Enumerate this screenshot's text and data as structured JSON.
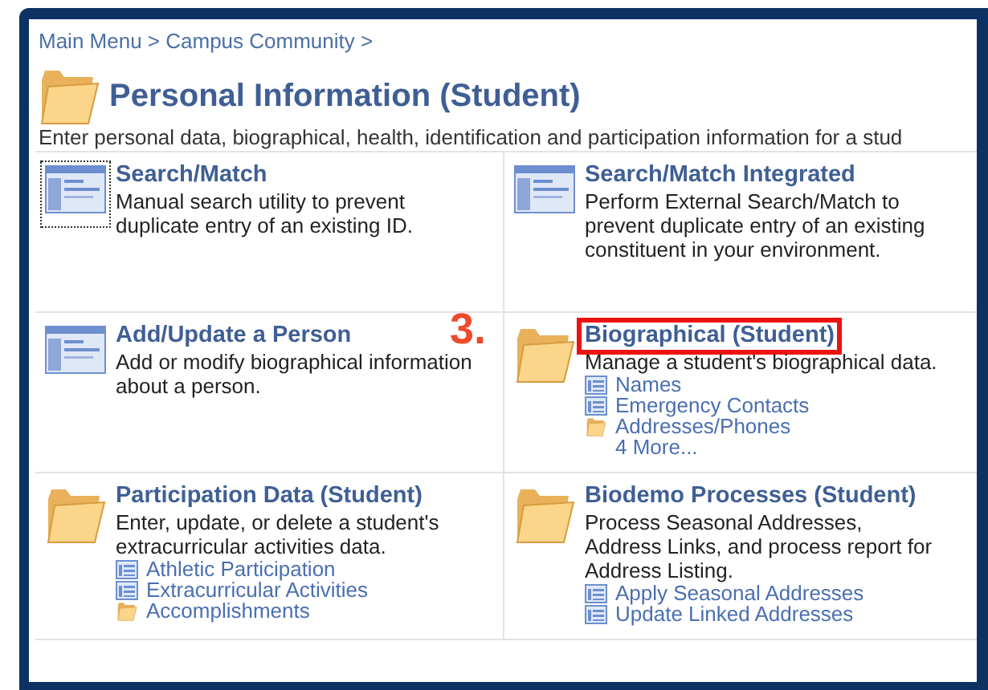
{
  "breadcrumb": "Main Menu > Campus Community >",
  "page": {
    "title": "Personal Information (Student)",
    "description": "Enter personal data, biographical, health, identification and participation information for a stud"
  },
  "annotation": "3.",
  "tiles": [
    {
      "kind": "page",
      "title": "Search/Match",
      "description": "Manual search utility to prevent duplicate entry of an existing ID.",
      "focused": true,
      "highlighted": false
    },
    {
      "kind": "page",
      "title": "Search/Match Integrated",
      "description": "Perform External Search/Match to prevent duplicate entry of an existing constituent in your environment.",
      "focused": false,
      "highlighted": false
    },
    {
      "kind": "page",
      "title": "Add/Update a Person",
      "description": "Add or modify biographical information about a person.",
      "focused": false,
      "highlighted": false
    },
    {
      "kind": "folder",
      "title": "Biographical (Student)",
      "description": "Manage a student's biographical data.",
      "focused": false,
      "highlighted": true,
      "links": [
        {
          "kind": "page",
          "label": "Names"
        },
        {
          "kind": "page",
          "label": "Emergency Contacts"
        },
        {
          "kind": "folder",
          "label": "Addresses/Phones"
        },
        {
          "kind": "more",
          "label": "4 More..."
        }
      ]
    },
    {
      "kind": "folder",
      "title": "Participation Data (Student)",
      "description": "Enter, update, or delete a student's extracurricular activities data.",
      "focused": false,
      "highlighted": false,
      "links": [
        {
          "kind": "page",
          "label": "Athletic Participation"
        },
        {
          "kind": "page",
          "label": "Extracurricular Activities"
        },
        {
          "kind": "folder",
          "label": "Accomplishments"
        }
      ]
    },
    {
      "kind": "folder",
      "title": "Biodemo Processes (Student)",
      "description": "Process Seasonal Addresses, Address Links, and process report for Address Listing.",
      "focused": false,
      "highlighted": false,
      "links": [
        {
          "kind": "page",
          "label": "Apply Seasonal Addresses"
        },
        {
          "kind": "page",
          "label": "Update Linked Addresses"
        }
      ]
    }
  ]
}
